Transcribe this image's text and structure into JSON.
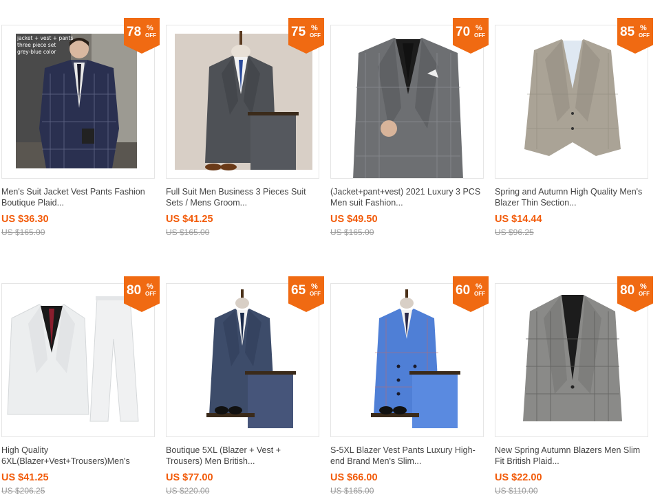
{
  "products": [
    {
      "discount": "78",
      "pct": "%",
      "off": "OFF",
      "title": "Men's Suit Jacket Vest Pants Fashion Boutique Plaid...",
      "price": "US $36.30",
      "original": "US $165.00",
      "image": "plaid-three-piece-suit-navy-photo"
    },
    {
      "discount": "75",
      "pct": "%",
      "off": "OFF",
      "title": "Full Suit Men Business 3 Pieces Suit Sets / Mens Groom...",
      "price": "US $41.25",
      "original": "US $165.00",
      "image": "grey-suit-on-mannequin"
    },
    {
      "discount": "70",
      "pct": "%",
      "off": "OFF",
      "title": "(Jacket+pant+vest) 2021 Luxury 3 PCS Men suit Fashion...",
      "price": "US $49.50",
      "original": "US $165.00",
      "image": "grey-check-suit-model"
    },
    {
      "discount": "85",
      "pct": "%",
      "off": "OFF",
      "title": "Spring and Autumn High Quality Men's Blazer Thin Section...",
      "price": "US $14.44",
      "original": "US $96.25",
      "image": "beige-blazer"
    },
    {
      "discount": "80",
      "pct": "%",
      "off": "OFF",
      "title": "High Quality 6XL(Blazer+Vest+Trousers)Men's",
      "price": "US $41.25",
      "original": "US $206.25",
      "image": "white-suit-set"
    },
    {
      "discount": "65",
      "pct": "%",
      "off": "OFF",
      "title": "Boutique 5XL (Blazer + Vest + Trousers) Men British...",
      "price": "US $77.00",
      "original": "US $220.00",
      "image": "blue-plaid-suit-mannequin"
    },
    {
      "discount": "60",
      "pct": "%",
      "off": "OFF",
      "title": "S-5XL Blazer Vest Pants Luxury High-end Brand Men's Slim...",
      "price": "US $66.00",
      "original": "US $165.00",
      "image": "light-blue-double-breasted-suit"
    },
    {
      "discount": "80",
      "pct": "%",
      "off": "OFF",
      "title": "New Spring Autumn Blazers Men Slim Fit British Plaid...",
      "price": "US $22.00",
      "original": "US $110.00",
      "image": "grey-plaid-blazer"
    }
  ],
  "image_overlay": {
    "line1": "jacket + vest + pants",
    "line2": "three piece set",
    "line3": "grey-blue color"
  },
  "colors": {
    "badge": "#f06a12",
    "price": "#f25b0a"
  }
}
